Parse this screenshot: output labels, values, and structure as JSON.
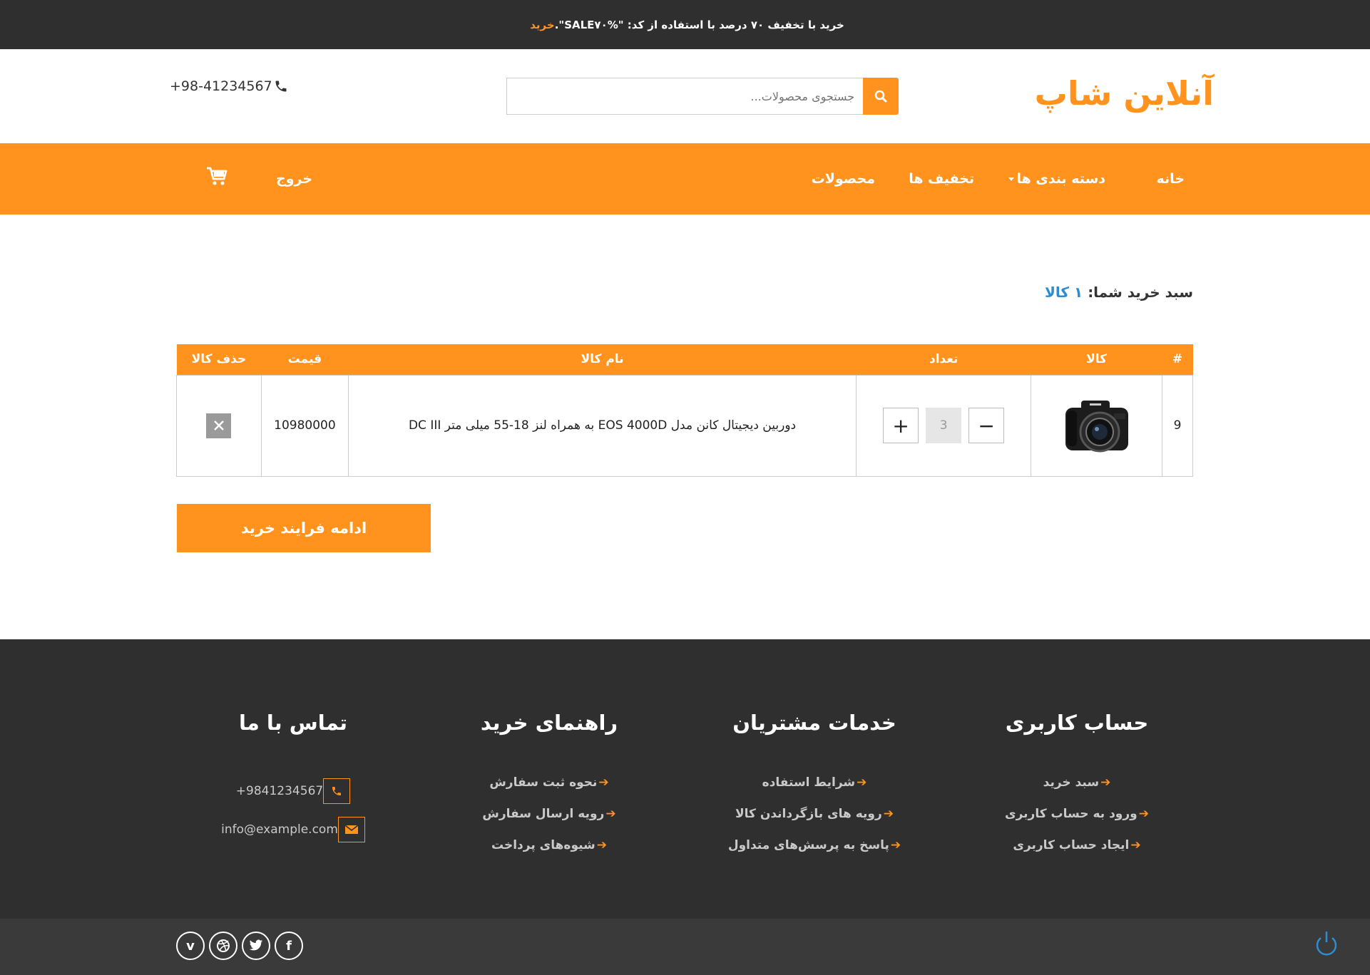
{
  "promo": {
    "text": "خرید با تخفیف ۷۰ درصد با استفاده از کد: \"SALE۷۰%\".",
    "link": "خرید"
  },
  "header": {
    "logo": "آنلاین شاپ",
    "search_placeholder": "جستجوی محصولات...",
    "phone": "+98-41234567"
  },
  "nav": {
    "home": "خانه",
    "categories": "دسته بندی ها",
    "discounts": "تخفیف ها",
    "products": "محصولات",
    "logout": "خروج"
  },
  "cart": {
    "title_label": "سبد خرید شما:",
    "count_label": "۱ کالا",
    "headers": [
      "#",
      "کالا",
      "تعداد",
      "نام کالا",
      "قیمت",
      "حذف کالا"
    ],
    "items": [
      {
        "index": "9",
        "quantity": "3",
        "name": "دوربین دیجیتال کانن مدل EOS 4000D به همراه لنز 18-55 میلی متر DC III",
        "price": "10980000"
      }
    ],
    "continue_label": "ادامه فرایند خرید"
  },
  "footer": {
    "account": {
      "title": "حساب کاربری",
      "links": [
        "سبد خرید",
        "ورود به حساب کاربری",
        "ایجاد حساب کاربری"
      ]
    },
    "services": {
      "title": "خدمات مشتریان",
      "links": [
        "شرایط استفاده",
        "رویه های بازگرداندن کالا",
        "پاسخ به پرسش‌های متداول"
      ]
    },
    "guide": {
      "title": "راهنمای خرید",
      "links": [
        "نحوه ثبت سفارش",
        "رویه ارسال سفارش",
        "شیوه‌های پرداخت"
      ]
    },
    "contact": {
      "title": "تماس با ما",
      "phone": "+9841234567",
      "email": "info@example.com"
    }
  },
  "colors": {
    "accent": "#ff931e",
    "dark": "#2f2f2f",
    "link_blue": "#2e8dd0"
  }
}
